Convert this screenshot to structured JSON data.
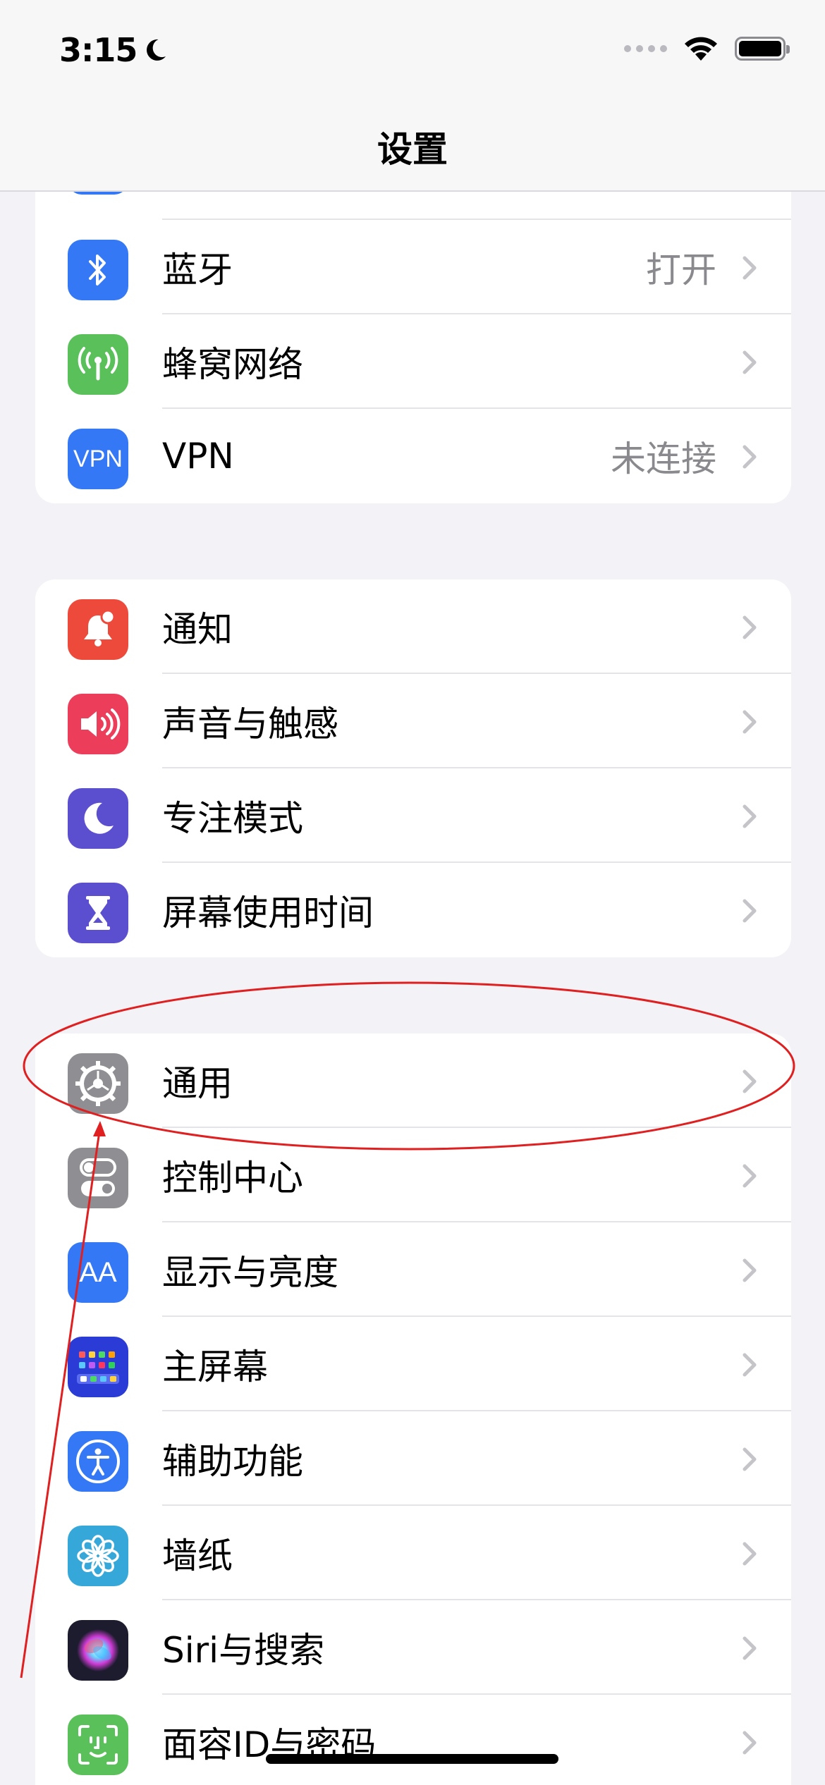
{
  "status": {
    "time": "3:15"
  },
  "nav": {
    "title": "设置"
  },
  "group1": [
    {
      "label": "蓝牙",
      "value": "打开",
      "icon": "bluetooth-icon",
      "color": "#3478f6"
    },
    {
      "label": "蜂窝网络",
      "value": "",
      "icon": "cellular-icon",
      "color": "#5ac15a"
    },
    {
      "label": "VPN",
      "value": "未连接",
      "icon": "vpn-icon",
      "icon_text": "VPN",
      "color": "#3478f6"
    }
  ],
  "group2": [
    {
      "label": "通知",
      "icon": "notification-bell-icon",
      "color": "#ee4a3c"
    },
    {
      "label": "声音与触感",
      "icon": "speaker-icon",
      "color": "#ec3d5a"
    },
    {
      "label": "专注模式",
      "icon": "moon-icon",
      "color": "#5b4fd0"
    },
    {
      "label": "屏幕使用时间",
      "icon": "hourglass-icon",
      "color": "#5b4fd0"
    }
  ],
  "group3": [
    {
      "label": "通用",
      "icon": "gear-icon",
      "color": "#8e8e93"
    },
    {
      "label": "控制中心",
      "icon": "toggles-icon",
      "color": "#8e8e93"
    },
    {
      "label": "显示与亮度",
      "icon": "text-size-icon",
      "icon_text": "AA",
      "color": "#3478f6"
    },
    {
      "label": "主屏幕",
      "icon": "home-screen-icon",
      "color": "#2a3bd6"
    },
    {
      "label": "辅助功能",
      "icon": "accessibility-icon",
      "color": "#3478f6"
    },
    {
      "label": "墙纸",
      "icon": "wallpaper-flower-icon",
      "color": "#35a8d9"
    },
    {
      "label": "Siri与搜索",
      "icon": "siri-icon",
      "color": "#1c1c2e"
    },
    {
      "label": "面容ID与密码",
      "icon": "face-id-icon",
      "color": "#5ac15a"
    }
  ],
  "colors": {
    "annotation": "#e02020",
    "chevron": "#c4c4c9"
  }
}
